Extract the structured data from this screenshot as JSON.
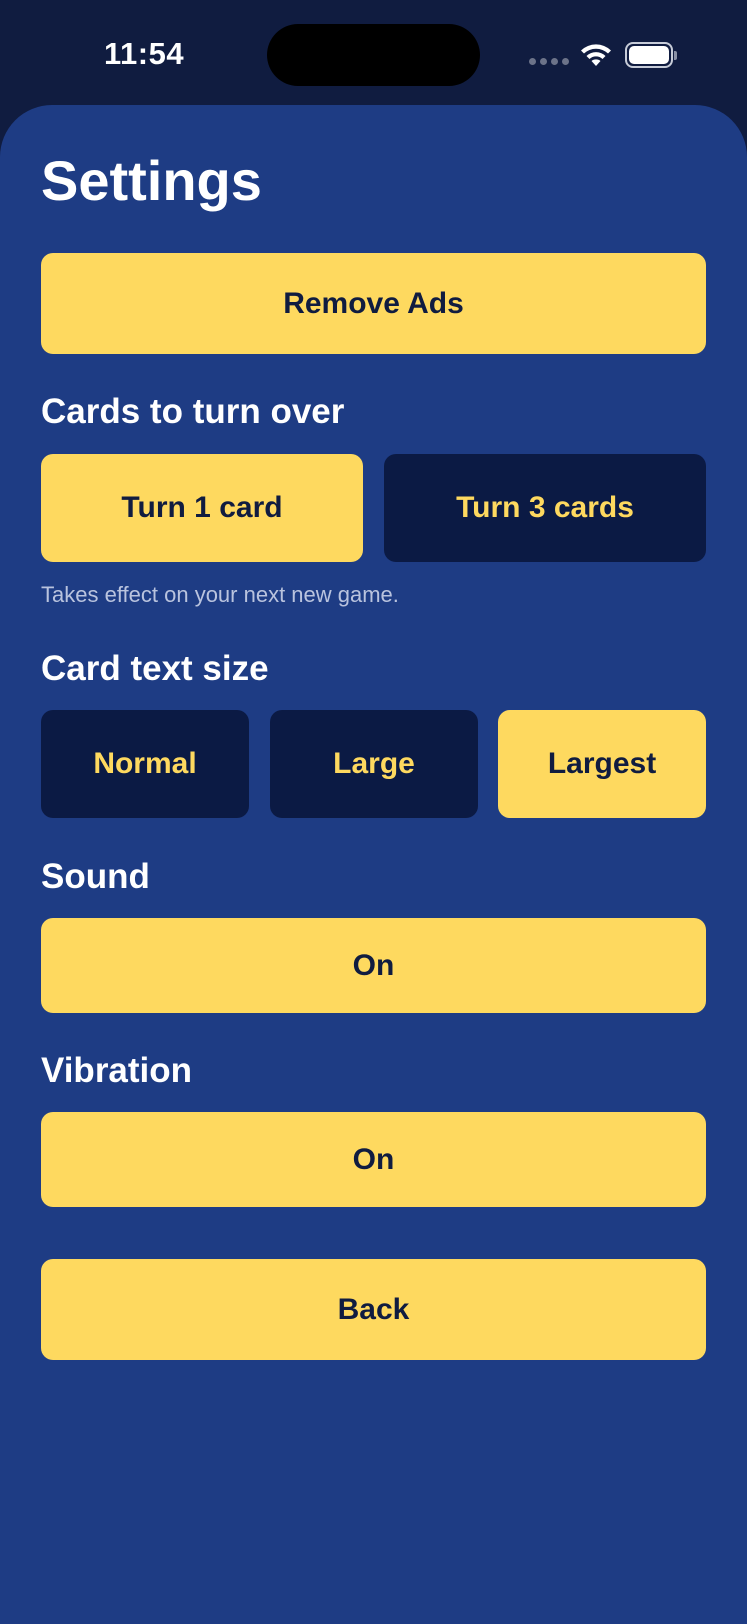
{
  "status_bar": {
    "time": "11:54",
    "icons": [
      "cellular-signal-icon",
      "wifi-icon",
      "battery-icon"
    ]
  },
  "page": {
    "title": "Settings"
  },
  "remove_ads": {
    "label": "Remove Ads"
  },
  "cards_to_turn": {
    "heading": "Cards to turn over",
    "options": [
      "Turn 1 card",
      "Turn 3 cards"
    ],
    "selected": "Turn 1 card",
    "hint": "Takes effect on your next new game."
  },
  "text_size": {
    "heading": "Card text size",
    "options": [
      "Normal",
      "Large",
      "Largest"
    ],
    "selected": "Largest"
  },
  "sound": {
    "heading": "Sound",
    "value": "On"
  },
  "vibration": {
    "heading": "Vibration",
    "value": "On"
  },
  "back": {
    "label": "Back"
  },
  "colors": {
    "background": "#1e3c84",
    "status_bar": "#101c40",
    "accent_yellow": "#fed95f",
    "unselected_button": "#0b1a44",
    "dark_text": "#101c40"
  }
}
